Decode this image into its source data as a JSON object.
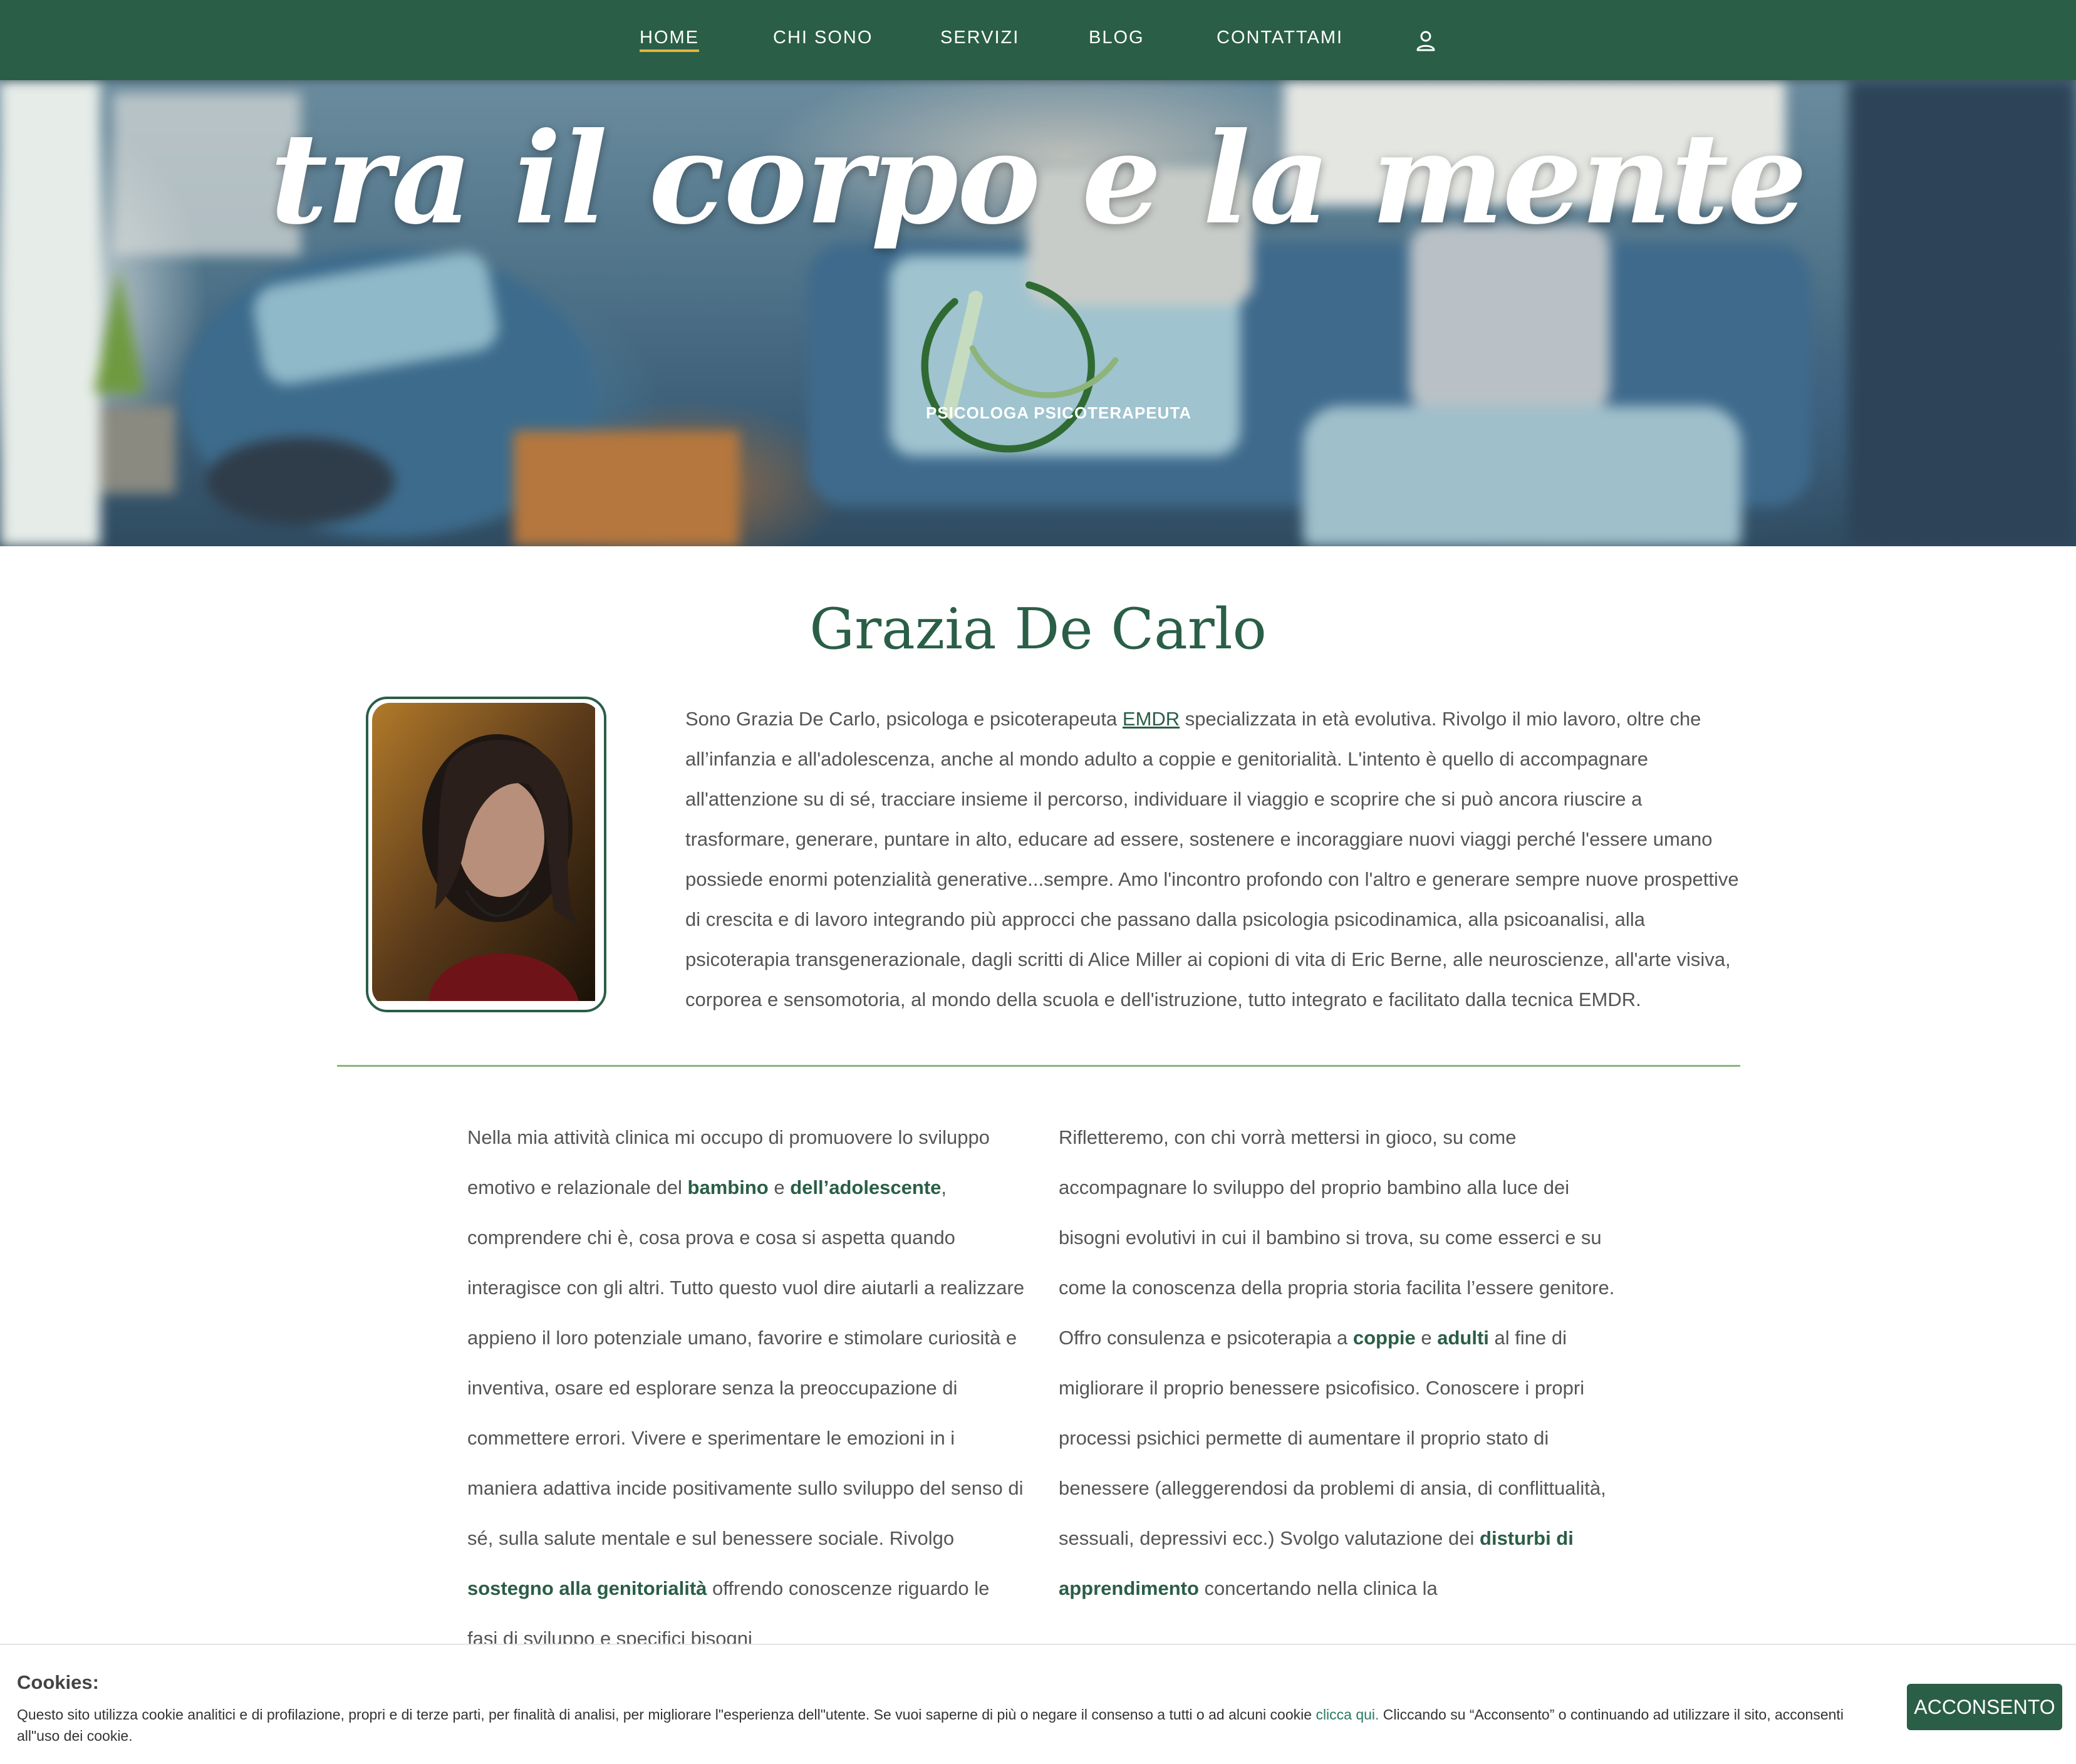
{
  "nav": {
    "items": [
      {
        "label": "HOME",
        "active": true
      },
      {
        "label": "CHI SONO"
      },
      {
        "label": "SERVIZI"
      },
      {
        "label": "BLOG"
      },
      {
        "label": "CONTATTAMI"
      }
    ],
    "user_icon": "user-icon"
  },
  "hero": {
    "title": "tra il corpo e la mente",
    "logo_subtitle": "PSICOLOGA PSICOTERAPEUTA"
  },
  "intro": {
    "name": "Grazia De Carlo",
    "text_before_link": "Sono Grazia De Carlo, psicologa e psicoterapeuta ",
    "link": "EMDR",
    "text_after_link": " specializzata in età evolutiva. Rivolgo il mio lavoro, oltre che all’infanzia e all'adolescenza, anche al mondo adulto a coppie e genitorialità. L'intento è quello di accompagnare all'attenzione su di sé, tracciare insieme il percorso, individuare il viaggio e scoprire che si può ancora riuscire a trasformare, generare, puntare in alto, educare ad essere, sostenere e incoraggiare nuovi viaggi perché l'essere umano possiede enormi potenzialità generative...sempre. Amo l'incontro profondo con l'altro e generare sempre nuove prospettive di crescita e di lavoro integrando più approcci che passano dalla psicologia psicodinamica, alla psicoanalisi, alla psicoterapia transgenerazionale, dagli scritti di Alice Miller ai copioni di vita di Eric Berne, alle neuroscienze, all'arte visiva, corporea e sensomotoria, al mondo della scuola e dell'istruzione, tutto integrato e facilitato dalla tecnica EMDR."
  },
  "left_col": {
    "p1": "Nella mia attività clinica mi occupo di promuovere lo sviluppo emotivo e relazionale del ",
    "b1": "bambino",
    "p2": " e ",
    "b2": "dell’adolescente",
    "p3": ", comprendere chi è, cosa prova e cosa si aspetta quando interagisce con gli altri. Tutto questo vuol dire aiutarli a realizzare appieno il loro potenziale umano, favorire e stimolare curiosità e inventiva, osare ed esplorare senza la preoccupazione di commettere errori. Vivere e sperimentare le emozioni in i maniera adattiva incide positivamente sullo sviluppo del senso di sé, sulla salute mentale e sul benessere sociale. Rivolgo ",
    "b3": "sostegno alla genitorialità",
    "p4": " offrendo conoscenze riguardo le fasi di sviluppo e specifici bisogni"
  },
  "right_col": {
    "para1": "Rifletteremo, con chi vorrà mettersi in gioco, su come accompagnare lo sviluppo del proprio bambino alla luce dei bisogni evolutivi in cui il bambino si trova, su come esserci e su come la conoscenza della propria storia facilita l’essere genitore.",
    "p1": "Offro consulenza e psicoterapia a ",
    "b1": "coppie",
    "p2": " e ",
    "b2": "adulti",
    "p3": " al fine di migliorare il proprio benessere psicofisico. Conoscere i propri processi psichici permette di aumentare il proprio stato di benessere (alleggerendosi da problemi di ansia, di conflittualità, sessuali, depressivi ecc.) Svolgo valutazione dei ",
    "b3": "disturbi di apprendimento",
    "p4": " concertando nella clinica la"
  },
  "cookie": {
    "title": "Cookies:",
    "text": "Questo sito utilizza cookie analitici e di profilazione, propri e di terze parti, per finalità di analisi, per migliorare l\"esperienza dell\"utente. Se vuoi saperne di più o negare il consenso a tutti o ad alcuni cookie ",
    "link": "clicca qui.",
    "text_after": " Cliccando su “Acconsento” o continuando ad utilizzare il sito, acconsenti all\"uso dei cookie.",
    "button": "ACCONSENTO"
  },
  "colors": {
    "brand_green": "#2a5e47",
    "accent_underline": "#e8b43a",
    "divider": "#8bb57c"
  }
}
